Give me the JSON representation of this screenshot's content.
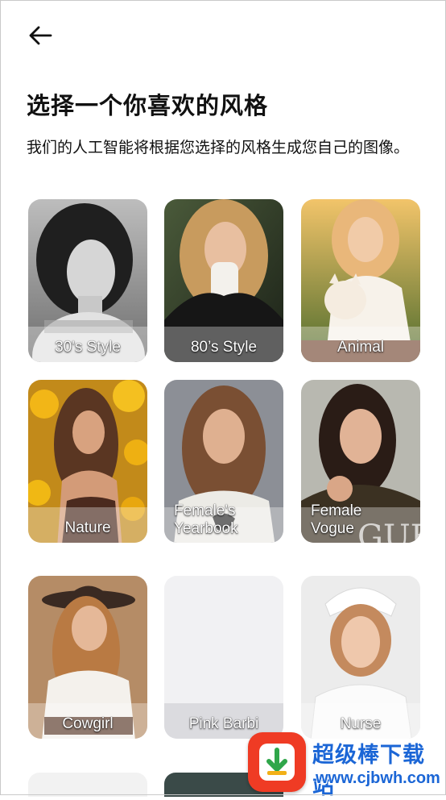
{
  "header": {
    "back_label": ""
  },
  "title": "选择一个你喜欢的风格",
  "subtitle": "我们的人工智能将根据您选择的风格生成您自己的图像。",
  "styles": [
    {
      "label": "30's Style",
      "tone": "bw"
    },
    {
      "label": "80’s Style",
      "tone": "dark-jacket"
    },
    {
      "label": "Animal",
      "tone": "sunlit-cat"
    },
    {
      "label": "Nature",
      "tone": "sunflowers"
    },
    {
      "label_line1": "Female's",
      "label_line2": "Yearbook",
      "tone": "yearbook"
    },
    {
      "label_line1": "Female",
      "label_line2": "Vogue",
      "tone": "vogue"
    },
    {
      "label": "Cowgirl",
      "tone": "western"
    },
    {
      "label": "Pink Barbi",
      "tone": "empty"
    },
    {
      "label": "Nurse",
      "tone": "nurse"
    }
  ],
  "watermark": {
    "cn_text": "超级棒下载站",
    "url_text": "www.cjbwh.com"
  },
  "colors": {
    "background": "#ffffff",
    "watermark_blue": "#1b66d6",
    "watermark_red": "#ef3b24"
  }
}
